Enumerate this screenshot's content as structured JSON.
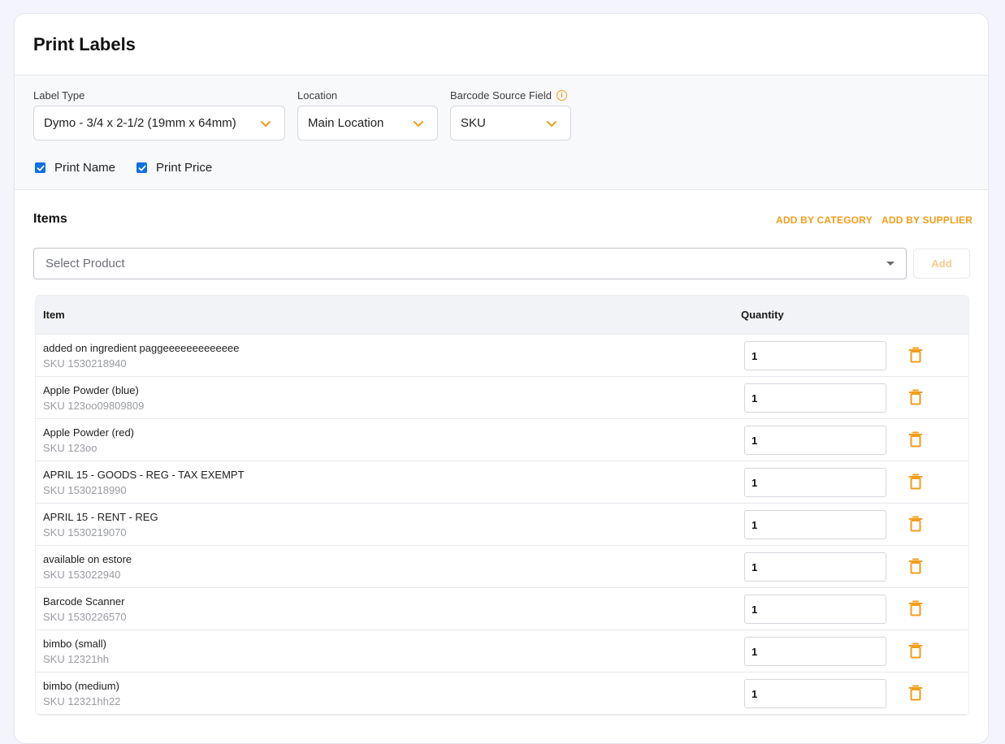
{
  "page": {
    "title": "Print Labels"
  },
  "settings": {
    "label_type": {
      "label": "Label Type",
      "value": "Dymo - 3/4 x 2-1/2 (19mm x 64mm)"
    },
    "location": {
      "label": "Location",
      "value": "Main Location"
    },
    "barcode_source": {
      "label": "Barcode Source Field",
      "value": "SKU",
      "info_icon": "i"
    },
    "print_name": {
      "label": "Print Name",
      "checked": true
    },
    "print_price": {
      "label": "Print Price",
      "checked": true
    }
  },
  "items": {
    "title": "Items",
    "add_by_category": "ADD BY CATEGORY",
    "add_by_supplier": "ADD BY SUPPLIER",
    "product_placeholder": "Select Product",
    "add_button": "Add",
    "columns": {
      "item": "Item",
      "quantity": "Quantity"
    },
    "rows": [
      {
        "name": "added on ingredient paggeeeeeeeeeeeee",
        "sku": "SKU 1530218940",
        "qty": "1"
      },
      {
        "name": "Apple Powder (blue)",
        "sku": "SKU 123oo09809809",
        "qty": "1"
      },
      {
        "name": "Apple Powder (red)",
        "sku": "SKU 123oo",
        "qty": "1"
      },
      {
        "name": "APRIL 15 - GOODS - REG - TAX EXEMPT",
        "sku": "SKU 1530218990",
        "qty": "1"
      },
      {
        "name": "APRIL 15 - RENT - REG",
        "sku": "SKU 1530219070",
        "qty": "1"
      },
      {
        "name": "available on estore",
        "sku": "SKU 153022940",
        "qty": "1"
      },
      {
        "name": "Barcode Scanner",
        "sku": "SKU 1530226570",
        "qty": "1"
      },
      {
        "name": "bimbo (small)",
        "sku": "SKU 12321hh",
        "qty": "1"
      },
      {
        "name": "bimbo (medium)",
        "sku": "SKU 12321hh22",
        "qty": "1"
      }
    ]
  },
  "colors": {
    "accent": "#f29d1b",
    "checkbox": "#0f6fe6"
  }
}
